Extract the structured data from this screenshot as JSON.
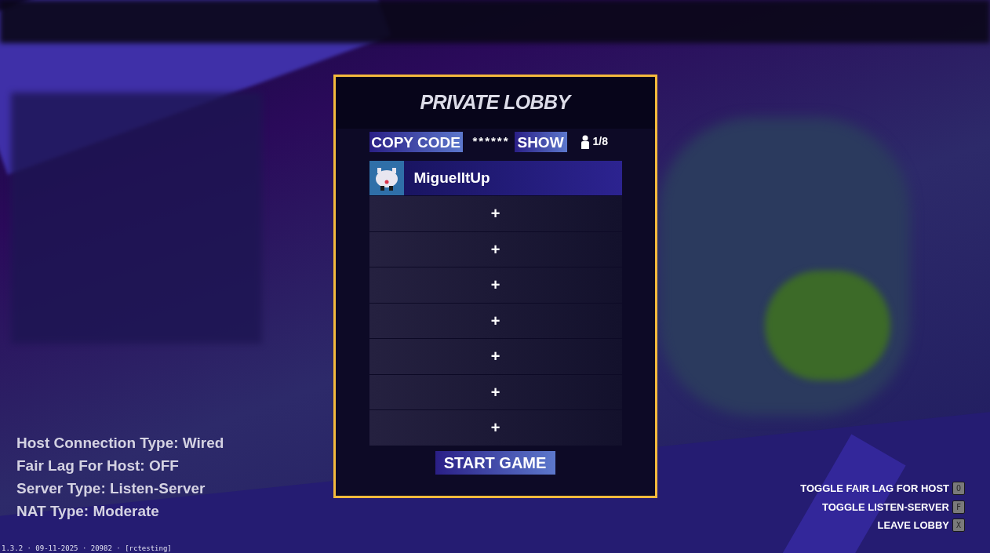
{
  "lobby": {
    "title": "PRIVATE LOBBY",
    "copy_button": "COPY CODE",
    "code": "******",
    "show_button": "SHOW",
    "player_count": "1/8",
    "slots": [
      {
        "kind": "player",
        "name": "MiguelItUp"
      },
      {
        "kind": "empty",
        "label": "+"
      },
      {
        "kind": "empty",
        "label": "+"
      },
      {
        "kind": "empty",
        "label": "+"
      },
      {
        "kind": "empty",
        "label": "+"
      },
      {
        "kind": "empty",
        "label": "+"
      },
      {
        "kind": "empty",
        "label": "+"
      },
      {
        "kind": "empty",
        "label": "+"
      }
    ],
    "start_button": "START GAME"
  },
  "info": [
    "Host Connection Type: Wired",
    "Fair Lag For Host: OFF",
    "Server Type: Listen-Server",
    "NAT Type: Moderate"
  ],
  "controls": [
    {
      "label": "TOGGLE FAIR LAG FOR HOST",
      "key": "O"
    },
    {
      "label": "TOGGLE LISTEN-SERVER",
      "key": "F"
    },
    {
      "label": "LEAVE LOBBY",
      "key": "X"
    }
  ],
  "version": "1.3.2 · 09-11-2025 · 20982 · [rctesting]"
}
